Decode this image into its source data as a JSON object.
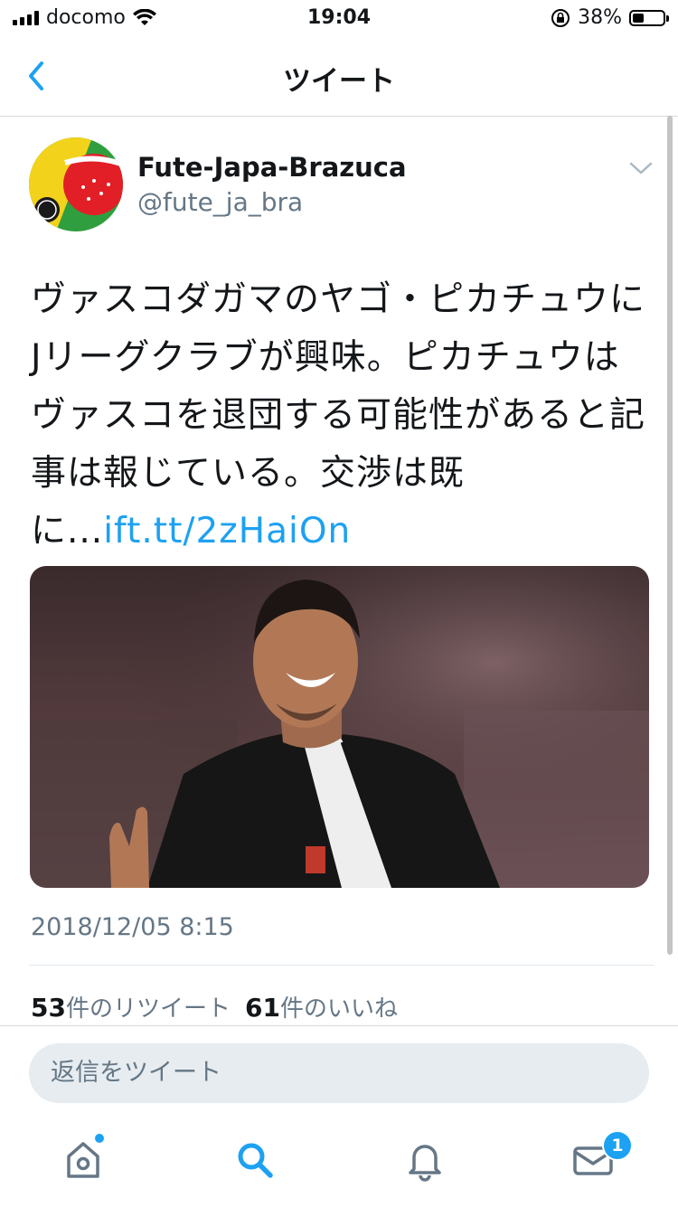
{
  "status_bar": {
    "carrier": "docomo",
    "time": "19:04",
    "battery": "38%",
    "battery_level": 0.38
  },
  "nav": {
    "title": "ツイート"
  },
  "tweet": {
    "user_name": "Fute-Japa-Brazuca",
    "handle": "@fute_ja_bra",
    "text": "ヴァスコダガマのヤゴ・ピカチュウにJリーグクラブが興味。ピカチュウはヴァスコを退団する可能性があると記事は報じている。交渉は既に...",
    "link": "ift.tt/2zHaiOn",
    "timestamp": "2018/12/05 8:15",
    "retweet_count": "53",
    "retweet_label": "件のリツイート",
    "like_count": "61",
    "like_label": "件のいいね"
  },
  "reply": {
    "placeholder": "返信をツイート"
  },
  "tab_bar": {
    "messages_badge": "1"
  },
  "colors": {
    "accent": "#1da1f2",
    "secondary_text": "#657786"
  }
}
